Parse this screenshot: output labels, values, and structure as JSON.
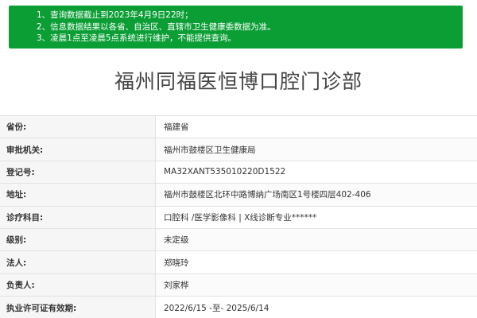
{
  "notice": {
    "lines": [
      "1、查询数据截止到2023年4月9日22时；",
      "2、信息数据结果以各省、自治区、直辖市卫生健康委数据为准。",
      "3、凌晨1点至凌晨5点系统进行维护，不能提供查询。"
    ],
    "background_color": "#0a9e35"
  },
  "title": "福州同福医恒博口腔门诊部",
  "rows": [
    {
      "label": "省份:",
      "value": "福建省"
    },
    {
      "label": "审批机关:",
      "value": "福州市鼓楼区卫生健康局"
    },
    {
      "label": "登记号:",
      "value": "MA32XANT535010220D1522"
    },
    {
      "label": "地址:",
      "value": "福州市鼓楼区北环中路博纳广场南区1号楼四层402-406"
    },
    {
      "label": "诊疗科目:",
      "value": "口腔科 /医学影像科  |  X线诊断专业******"
    },
    {
      "label": "级别:",
      "value": "未定级"
    },
    {
      "label": "法人:",
      "value": "郑晓玲"
    },
    {
      "label": "负责人:",
      "value": "刘家桦"
    },
    {
      "label": "执业许可证有效期:",
      "value": "2022/6/15 -至- 2025/6/14"
    }
  ]
}
